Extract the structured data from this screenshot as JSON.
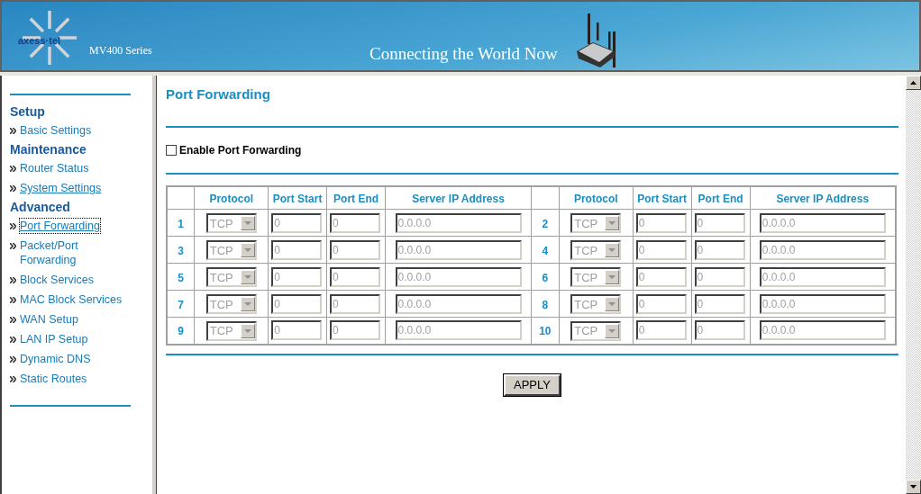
{
  "header": {
    "logo": "axess·tel",
    "series": "MV400 Series",
    "tagline": "Connecting the World Now"
  },
  "sidebar": {
    "sections": [
      {
        "heading": "Setup",
        "items": [
          {
            "label": "Basic Settings",
            "selected": false,
            "underlined": false
          }
        ]
      },
      {
        "heading": "Maintenance",
        "items": [
          {
            "label": "Router Status",
            "selected": false,
            "underlined": false
          },
          {
            "label": "System Settings",
            "selected": false,
            "underlined": true
          }
        ]
      },
      {
        "heading": "Advanced",
        "items": [
          {
            "label": "Port Forwarding",
            "selected": true,
            "underlined": true
          },
          {
            "label": "Packet/Port Forwarding",
            "selected": false,
            "underlined": false
          },
          {
            "label": "Block Services",
            "selected": false,
            "underlined": false
          },
          {
            "label": "MAC Block Services",
            "selected": false,
            "underlined": false
          },
          {
            "label": "WAN Setup",
            "selected": false,
            "underlined": false
          },
          {
            "label": "LAN IP Setup",
            "selected": false,
            "underlined": false
          },
          {
            "label": "Dynamic DNS",
            "selected": false,
            "underlined": false
          },
          {
            "label": "Static Routes",
            "selected": false,
            "underlined": false
          }
        ]
      }
    ]
  },
  "page": {
    "title": "Port Forwarding",
    "enable": {
      "label": "Enable Port Forwarding",
      "checked": false
    },
    "column_groups": [
      {
        "columns": [
          "Protocol",
          "Port Start",
          "Port End",
          "Server IP Address"
        ]
      },
      {
        "columns": [
          "Protocol",
          "Port Start",
          "Port End",
          "Server IP Address"
        ]
      }
    ],
    "entries": [
      {
        "number": "1",
        "protocol": "TCP",
        "port_start": "0",
        "port_end": "0",
        "server_ip": "0.0.0.0",
        "disabled": true
      },
      {
        "number": "2",
        "protocol": "TCP",
        "port_start": "0",
        "port_end": "0",
        "server_ip": "0.0.0.0",
        "disabled": true
      },
      {
        "number": "3",
        "protocol": "TCP",
        "port_start": "0",
        "port_end": "0",
        "server_ip": "0.0.0.0",
        "disabled": true
      },
      {
        "number": "4",
        "protocol": "TCP",
        "port_start": "0",
        "port_end": "0",
        "server_ip": "0.0.0.0",
        "disabled": true
      },
      {
        "number": "5",
        "protocol": "TCP",
        "port_start": "0",
        "port_end": "0",
        "server_ip": "0.0.0.0",
        "disabled": true
      },
      {
        "number": "6",
        "protocol": "TCP",
        "port_start": "0",
        "port_end": "0",
        "server_ip": "0.0.0.0",
        "disabled": true
      },
      {
        "number": "7",
        "protocol": "TCP",
        "port_start": "0",
        "port_end": "0",
        "server_ip": "0.0.0.0",
        "disabled": true
      },
      {
        "number": "8",
        "protocol": "TCP",
        "port_start": "0",
        "port_end": "0",
        "server_ip": "0.0.0.0",
        "disabled": true
      },
      {
        "number": "9",
        "protocol": "TCP",
        "port_start": "0",
        "port_end": "0",
        "server_ip": "0.0.0.0",
        "disabled": true
      },
      {
        "number": "10",
        "protocol": "TCP",
        "port_start": "0",
        "port_end": "0",
        "server_ip": "0.0.0.0",
        "disabled": true
      }
    ],
    "apply": "APPLY"
  }
}
